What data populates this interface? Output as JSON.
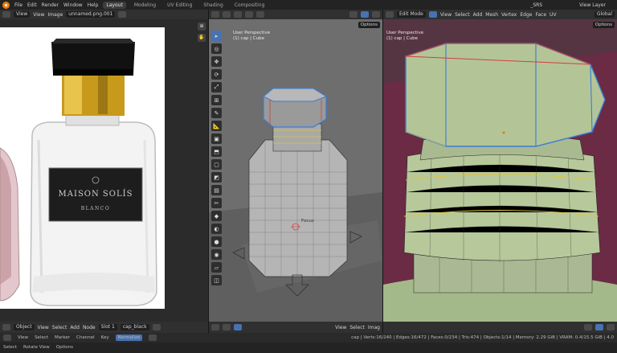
{
  "topbar": {
    "menus": [
      "File",
      "Edit",
      "Render",
      "Window",
      "Help"
    ],
    "tabs": [
      "Layout",
      "Modeling",
      "UV Editing",
      "Shading",
      "Compositing"
    ],
    "active_tab": "Layout",
    "scene": "_SRS",
    "view_layer": "View Layer"
  },
  "image_editor": {
    "view_menu": "View",
    "view2": "View",
    "image_menu": "Image",
    "image_name": "unnamed.png.001",
    "bottle_brand": "MAISON SOLÍS",
    "bottle_sub": "BLANCO"
  },
  "viewport_left": {
    "options": "Options",
    "perspective": "User Perspective",
    "object": "(1) cap | Cube",
    "focus_label": "Focus"
  },
  "viewport_right": {
    "mode": "Edit Mode",
    "menus": [
      "View",
      "Select",
      "Add",
      "Mesh",
      "Vertex",
      "Edge",
      "Face",
      "UV"
    ],
    "transform": "Global",
    "options": "Options",
    "perspective": "User Perspective",
    "object": "(1) cap | Cube"
  },
  "node_editor_header": {
    "type": "Object",
    "menus": [
      "View",
      "Select",
      "Add",
      "Node"
    ],
    "slot": "Slot 1",
    "material": "cap_black"
  },
  "viewport_mid_header": {
    "menus": [
      "View",
      "Select",
      "Imag"
    ]
  },
  "dopesheet_header": {
    "menus": [
      "View",
      "Select",
      "Marker",
      "Channel",
      "Key"
    ],
    "normalize": "Normalize"
  },
  "statusbar": {
    "left": [
      "Select",
      "Rotate View",
      "Options"
    ],
    "stats": "cap | Verts:16/240 | Edges:16/472 | Faces:0/234 | Tris:474 | Objects:1/14 | Memory: 2.29 GiB | VRAM: 0.4/15.5 GiB | 4.0"
  }
}
